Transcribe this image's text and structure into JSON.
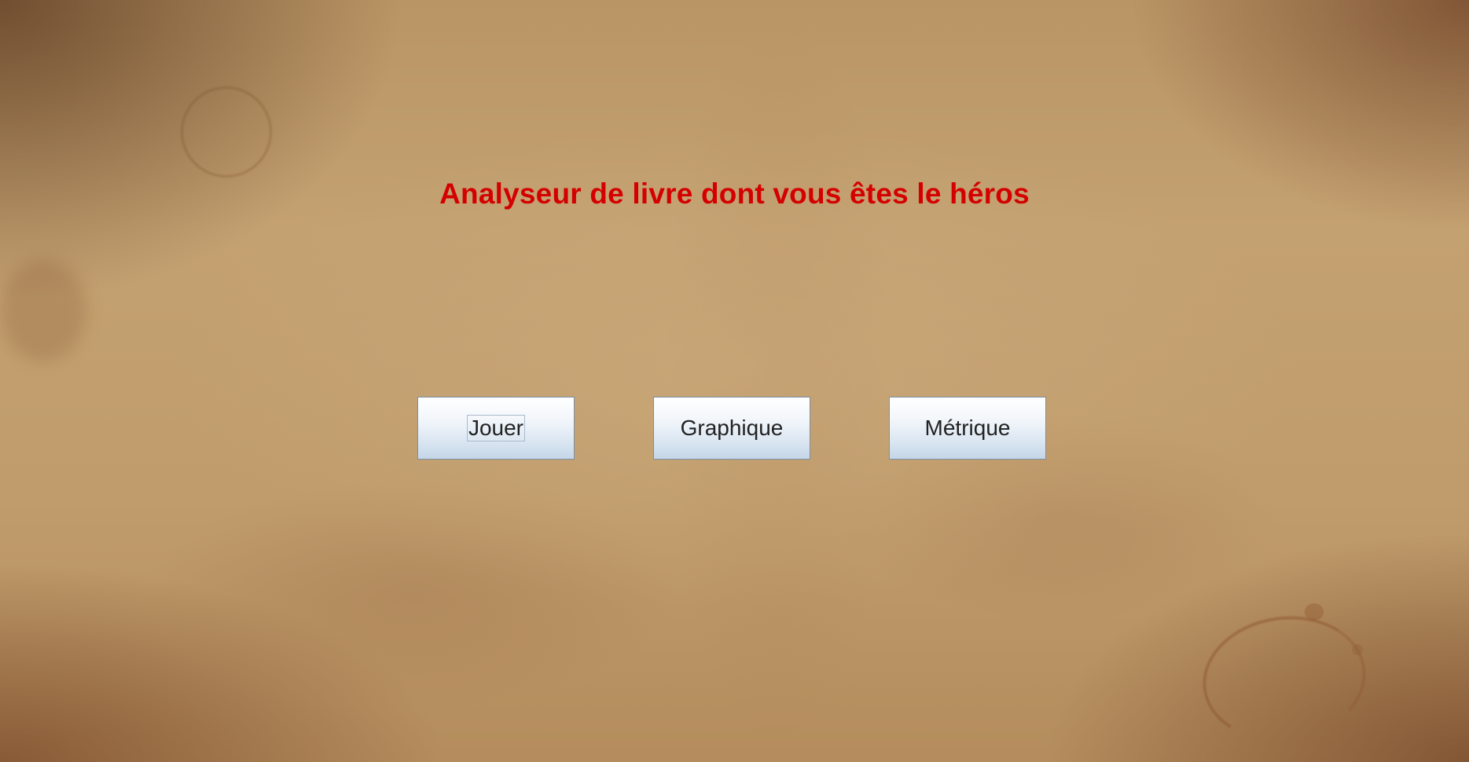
{
  "app": {
    "title": "Analyseur de livre dont vous êtes le héros"
  },
  "menu": {
    "buttons": [
      {
        "label": "Jouer",
        "focused": true
      },
      {
        "label": "Graphique",
        "focused": false
      },
      {
        "label": "Métrique",
        "focused": false
      }
    ]
  },
  "colors": {
    "title": "#d40000",
    "background": "#c09c6c",
    "button_top": "#ffffff",
    "button_bottom": "#c5d6e8",
    "button_border": "#7a8fa8"
  }
}
